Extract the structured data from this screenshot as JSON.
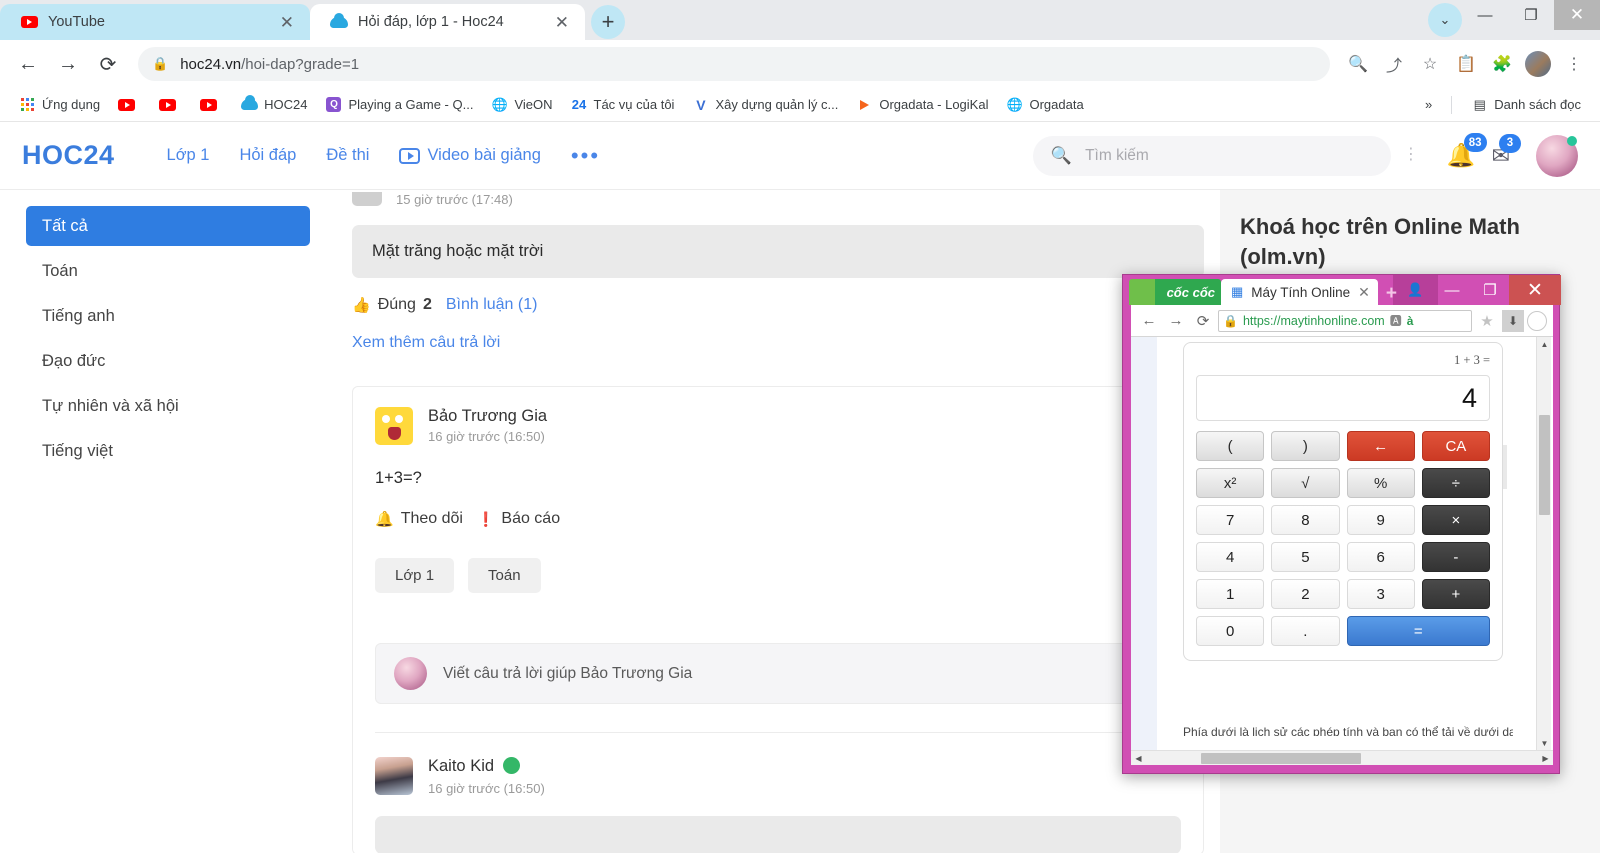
{
  "browser": {
    "tabs": [
      {
        "title": "YouTube",
        "favicon": "youtube-icon",
        "active": false
      },
      {
        "title": "Hỏi đáp, lớp 1 - Hoc24",
        "favicon": "hoc24-cloud-icon",
        "active": true
      }
    ],
    "new_tab_label": "+",
    "window_controls": {
      "chevron": "⌄",
      "minimize": "—",
      "maximize": "❐",
      "close": "✕"
    },
    "toolbar": {
      "back": "←",
      "forward": "→",
      "reload": "⟳",
      "lock_icon": "lock-icon",
      "url_host": "hoc24.vn",
      "url_path": "/hoi-dap?grade=1",
      "zoom_icon": "zoom-out-icon",
      "share_icon": "share-icon",
      "bookmark_icon": "star-icon",
      "extension_icon": "puzzle-icon",
      "notes_icon": "notes-extension-icon",
      "menu_icon": "three-dot-menu-icon"
    },
    "bookmarks": [
      {
        "label": "Ứng dụng",
        "icon": "apps-grid-icon"
      },
      {
        "label": "",
        "icon": "youtube-icon"
      },
      {
        "label": "",
        "icon": "youtube-icon"
      },
      {
        "label": "",
        "icon": "youtube-icon"
      },
      {
        "label": "HOC24",
        "icon": "hoc24-cloud-icon"
      },
      {
        "label": "Playing a Game - Q...",
        "icon": "quizizz-icon"
      },
      {
        "label": "VieON",
        "icon": "globe-icon"
      },
      {
        "label": "Tác vụ của tôi",
        "icon": "24-icon"
      },
      {
        "label": "Xây dựng quản lý c...",
        "icon": "v-icon"
      },
      {
        "label": "Orgadata - LogiKal",
        "icon": "orange-arrow-icon"
      },
      {
        "label": "Orgadata",
        "icon": "globe-icon"
      }
    ],
    "bookmarks_overflow": "»",
    "reading_list": {
      "label": "Danh sách đọc",
      "icon": "reading-list-icon"
    }
  },
  "site": {
    "logo": "HOC24",
    "nav": [
      {
        "label": "Lớp 1"
      },
      {
        "label": "Hỏi đáp"
      },
      {
        "label": "Đề thi"
      },
      {
        "label": "Video bài giảng",
        "icon": "video-play-icon"
      }
    ],
    "nav_more": "•••",
    "search": {
      "placeholder": "Tìm kiếm",
      "icon": "search-icon"
    },
    "header_dots": "⋮",
    "notifications": {
      "count": "83",
      "icon": "bell-icon"
    },
    "messages": {
      "count": "3",
      "icon": "envelope-icon"
    },
    "avatar": {
      "name": "avatar",
      "status": "online"
    }
  },
  "sidebar": {
    "items": [
      {
        "label": "Tất cả",
        "active": true
      },
      {
        "label": "Toán",
        "active": false
      },
      {
        "label": "Tiếng anh",
        "active": false
      },
      {
        "label": "Đạo đức",
        "active": false
      },
      {
        "label": "Tự nhiên và xã hội",
        "active": false
      },
      {
        "label": "Tiếng việt",
        "active": false
      }
    ]
  },
  "feed": {
    "answer_card": {
      "time": "15 giờ trước (17:48)",
      "quote": "Mặt trăng hoặc mặt trời",
      "like_icon": "thumbs-up-icon",
      "like_label": "Đúng",
      "like_count": "2",
      "comment_label": "Bình luận (1)",
      "more_answers": "Xem thêm câu trả lời"
    },
    "question_card": {
      "author": "Bảo Trương Gia",
      "time": "16 giờ trước (16:50)",
      "body": "1+3=?",
      "follow_icon": "bell-icon",
      "follow_label": "Theo dõi",
      "report_icon": "report-icon",
      "report_label": "Báo cáo",
      "tags": [
        "Lớp 1",
        "Toán"
      ],
      "comment_icon": "comment-bubble-icon",
      "reply_placeholder": "Viết câu trả lời giúp Bảo Trương Gia",
      "send_icon": "send-icon"
    },
    "second_answer": {
      "author": "Kaito Kid",
      "status": "online",
      "time": "16 giờ trước (16:50)"
    }
  },
  "right_rail": {
    "title": "Khoá học trên Online Math (olm.vn)"
  },
  "popup": {
    "window_title_controls": {
      "profile": "profile-icon",
      "minimize": "—",
      "maximize": "❐",
      "close": "✕"
    },
    "brand": "cốc cốc",
    "tab_title": "Máy Tính Online",
    "tab_icon": "calculator-icon",
    "tab_close": "✕",
    "new_tab": "+",
    "nav": {
      "back": "←",
      "forward": "→",
      "reload": "⟳"
    },
    "address": {
      "lock": "lock-icon",
      "url": "https://maytinhonline.com"
    },
    "omnibox_icons": [
      "translate-icon",
      "dictionary-icon"
    ],
    "star_icon": "star-icon",
    "download_icon": "download-icon",
    "profile_circle": "profile-circle-icon",
    "sidebar_toggle": "»",
    "calculator": {
      "expression": "1 + 3 =",
      "display": "4",
      "keys": [
        {
          "label": "(",
          "style": "light",
          "name": "paren-open"
        },
        {
          "label": ")",
          "style": "light",
          "name": "paren-close"
        },
        {
          "label": "←",
          "style": "red",
          "name": "backspace"
        },
        {
          "label": "CA",
          "style": "red",
          "name": "clear-all"
        },
        {
          "label": "x²",
          "style": "light",
          "name": "square"
        },
        {
          "label": "√",
          "style": "light",
          "name": "sqrt"
        },
        {
          "label": "%",
          "style": "light",
          "name": "percent"
        },
        {
          "label": "÷",
          "style": "dark",
          "name": "divide"
        },
        {
          "label": "7",
          "style": "white",
          "name": "digit-7"
        },
        {
          "label": "8",
          "style": "white",
          "name": "digit-8"
        },
        {
          "label": "9",
          "style": "white",
          "name": "digit-9"
        },
        {
          "label": "×",
          "style": "dark",
          "name": "multiply"
        },
        {
          "label": "4",
          "style": "white",
          "name": "digit-4"
        },
        {
          "label": "5",
          "style": "white",
          "name": "digit-5"
        },
        {
          "label": "6",
          "style": "white",
          "name": "digit-6"
        },
        {
          "label": "-",
          "style": "dark",
          "name": "minus"
        },
        {
          "label": "1",
          "style": "white",
          "name": "digit-1"
        },
        {
          "label": "2",
          "style": "white",
          "name": "digit-2"
        },
        {
          "label": "3",
          "style": "white",
          "name": "digit-3"
        },
        {
          "label": "+",
          "style": "dark",
          "name": "plus"
        },
        {
          "label": "0",
          "style": "white",
          "name": "digit-0"
        },
        {
          "label": ".",
          "style": "white",
          "name": "decimal-point"
        },
        {
          "label": "=",
          "style": "blue",
          "name": "equals"
        }
      ],
      "note": "Phía dưới là lịch sử các phép tính và bạn có thể tải về dưới dạng"
    }
  },
  "colors": {
    "brand_blue": "#3b7ddd",
    "sidebar_active": "#2f7de1",
    "badge_blue": "#2d7ff0",
    "popup_frame": "#d14fb4",
    "popup_close": "#cc5252",
    "key_red": "#cc3a24",
    "key_blue": "#3b79cf",
    "key_dark": "#333333",
    "online_green": "#34b768",
    "tab_inactive": "#bfe7f5"
  }
}
